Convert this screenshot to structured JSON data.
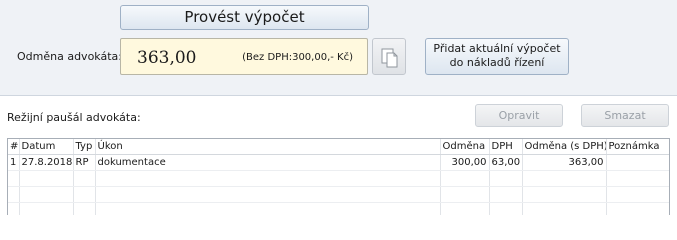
{
  "calc_button": "Provést výpočet",
  "fee": {
    "label": "Odměna advokáta:",
    "value": "363,00",
    "net_text": "(Bez DPH:300,00,- Kč)"
  },
  "add_button": {
    "line1": "Přidat aktuální výpočet",
    "line2": "do nákladů řízení"
  },
  "overhead": {
    "label": "Režijní paušál advokáta:",
    "edit_label": "Opravit",
    "delete_label": "Smazat",
    "columns": [
      "#",
      "Datum",
      "Typ",
      "Úkon",
      "Odměna",
      "DPH",
      "Odměna (s DPH)",
      "Poznámka"
    ],
    "rows": [
      {
        "num": "1",
        "date": "27.8.2018",
        "type": "RP",
        "action": "dokumentace",
        "fee": "300,00",
        "vat": "63,00",
        "fee_vat": "363,00",
        "note": ""
      }
    ]
  }
}
